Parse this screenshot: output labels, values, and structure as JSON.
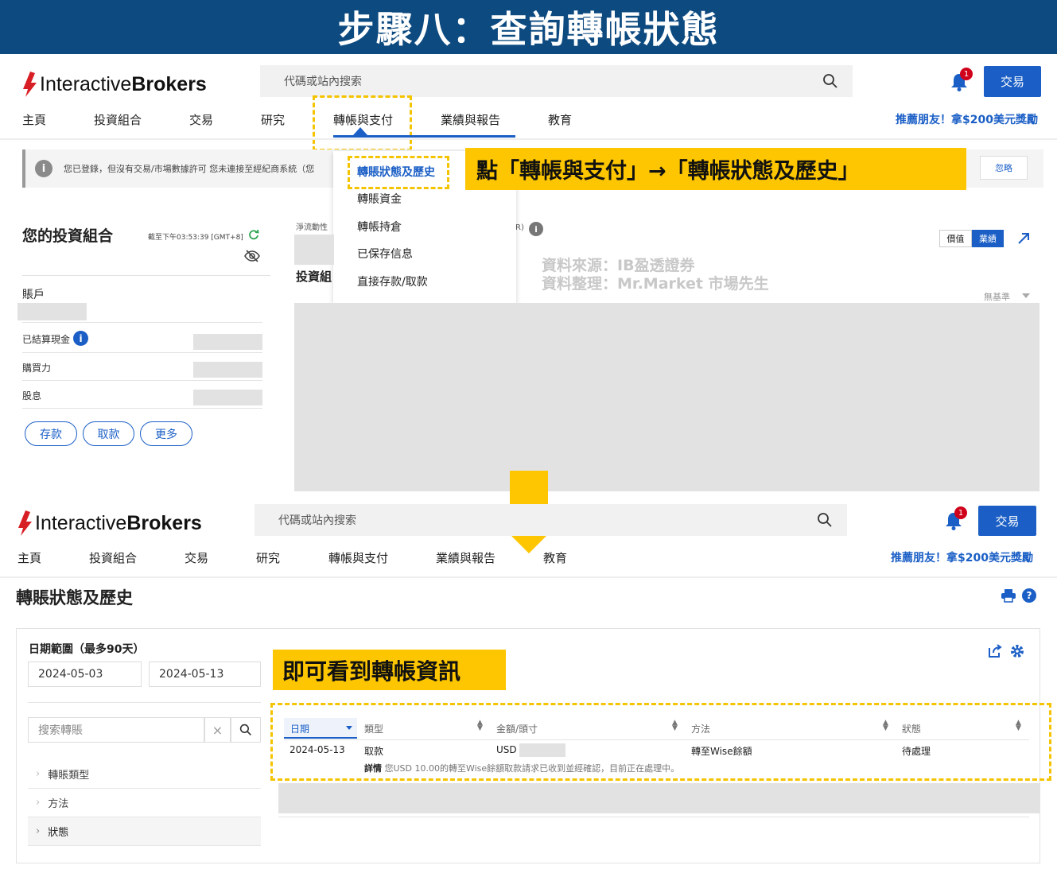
{
  "banner": {
    "title": "步驟八：查詢轉帳狀態"
  },
  "brand": {
    "logo_part1": "Interactive",
    "logo_part2": "Brokers"
  },
  "top": {
    "search_placeholder": "代碼或站內搜索",
    "notification_count": "1",
    "trade_label": "交易",
    "nav": [
      "主頁",
      "投資組合",
      "交易",
      "研究",
      "轉帳與支付",
      "業績與報告",
      "教育"
    ],
    "referral": "推薦朋友！拿$200美元獎勵",
    "notice_text": "您已登錄，但沒有交易/市場數據許可 您未連接至經紀商系統（您",
    "ignore_label": "忽略",
    "dropdown": [
      "轉賬狀態及歷史",
      "轉賬資金",
      "轉帳持倉",
      "已保存信息",
      "直接存款/取款"
    ],
    "callout": "點「轉帳與支付」→「轉帳狀態及歷史」",
    "portfolio": {
      "title": "您的投資組合",
      "timestamp": "截至下午03:53:39 [GMT+8]",
      "account_label": "賬戶",
      "rows": [
        "已結算現金",
        "購買力",
        "股息"
      ],
      "buttons": [
        "存款",
        "取款",
        "更多"
      ],
      "nav_movement_label": "淨流動性",
      "portfolio_label": "投資組",
      "r_fragment": "R)",
      "toggle": [
        "價值",
        "業績"
      ],
      "benchmark": "無基準"
    },
    "watermark": [
      "資料來源：IB盈透證券",
      "資料整理：Mr.Market 市場先生"
    ]
  },
  "bottom": {
    "search_placeholder": "代碼或站內搜索",
    "notification_count": "1",
    "trade_label": "交易",
    "nav": [
      "主頁",
      "投資組合",
      "交易",
      "研究",
      "轉帳與支付",
      "業績與報告",
      "教育"
    ],
    "referral": "推薦朋友！拿$200美元獎勵",
    "page_title": "轉賬狀態及歷史",
    "date_range_label": "日期範圍（最多90天）",
    "date_from": "2024-05-03",
    "date_to": "2024-05-13",
    "search_transfers_placeholder": "搜索轉賬",
    "filters": [
      "轉賬類型",
      "方法",
      "狀態"
    ],
    "callout": "即可看到轉帳資訊",
    "table": {
      "headers": [
        "日期",
        "類型",
        "金額/頭寸",
        "方法",
        "狀態"
      ],
      "row": {
        "date": "2024-05-13",
        "type": "取款",
        "currency": "USD",
        "method": "轉至Wise餘額",
        "status": "待處理"
      },
      "detail_label": "詳情",
      "detail_text": "您USD 10.00的轉至Wise餘額取款請求已收到並經確認，目前正在處理中。"
    }
  },
  "colors": {
    "banner": "#0d4a80",
    "brand_blue": "#1b5fc6",
    "highlight": "#fdc600",
    "logo_red": "#d81e25"
  }
}
